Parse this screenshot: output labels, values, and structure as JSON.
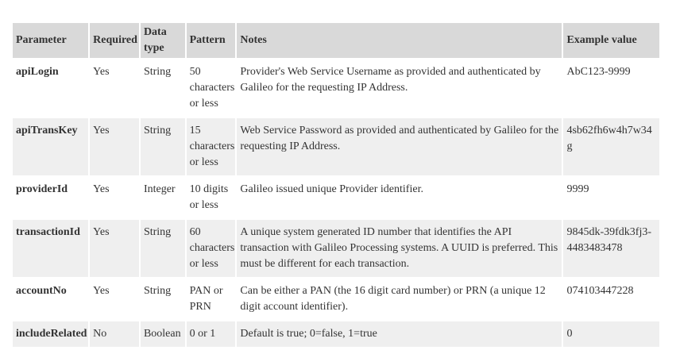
{
  "table": {
    "headers": {
      "parameter": "Parameter",
      "required": "Required",
      "data_type": "Data type",
      "pattern": "Pattern",
      "notes": "Notes",
      "example_value": "Example value"
    },
    "rows": [
      {
        "parameter": "apiLogin",
        "required": "Yes",
        "data_type": "String",
        "pattern": "50 characters or less",
        "notes": "Provider's Web Service Username as provided and authenticated by Galileo for the requesting IP Address.",
        "example_value": "AbC123-9999"
      },
      {
        "parameter": "apiTransKey",
        "required": "Yes",
        "data_type": "String",
        "pattern": "15 characters or less",
        "notes": "Web Service Password as provided and authenticated by Galileo for the requesting IP Address.",
        "example_value": "4sb62fh6w4h7w34g"
      },
      {
        "parameter": "providerId",
        "required": "Yes",
        "data_type": "Integer",
        "pattern": "10 digits or less",
        "notes": "Galileo issued unique Provider identifier.",
        "example_value": "9999"
      },
      {
        "parameter": "transactionId",
        "required": "Yes",
        "data_type": "String",
        "pattern": "60 characters or less",
        "notes": "A unique system generated ID number that identifies the API transaction with Galileo Processing systems. A UUID is preferred. This must be different for each transaction.",
        "example_value": "9845dk-39fdk3fj3-4483483478"
      },
      {
        "parameter": "accountNo",
        "required": "Yes",
        "data_type": "String",
        "pattern": "PAN or PRN",
        "notes": "Can be either a PAN (the 16 digit card number) or PRN (a unique 12 digit account identifier).",
        "example_value": "074103447228"
      },
      {
        "parameter": "includeRelated",
        "required": "No",
        "data_type": "Boolean",
        "pattern": "0 or 1",
        "notes": "Default is true; 0=false, 1=true",
        "example_value": "0"
      }
    ]
  }
}
